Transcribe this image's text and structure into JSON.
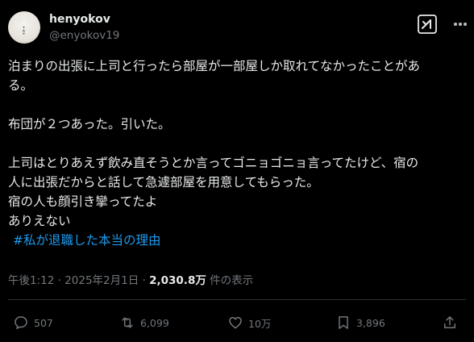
{
  "user": {
    "display_name": "henyokov",
    "handle": "@enyokov19",
    "avatar_face": "• ∧ •"
  },
  "header": {
    "grok_icon": "grok-icon",
    "more_icon": "more-options-icon"
  },
  "tweet": {
    "lines": [
      "泊まりの出張に上司と行ったら部屋が一部屋しか取れてなかったことがあ",
      "る。",
      "",
      "布団が２つあった。引いた。",
      "",
      "上司はとりあえず飲み直そうとか言ってゴニョゴニョ言ってたけど、宿の",
      "人に出張だからと話して急遽部屋を用意してもらった。",
      "宿の人も顔引き攣ってたよ",
      "ありえない"
    ],
    "hashtag": "#私が退職した本当の理由"
  },
  "meta": {
    "time": "午後1:12 · 2025年2月1日 · ",
    "views_count": "2,030.8万",
    "views_label": " 件の表示"
  },
  "actions": {
    "reply_count": "507",
    "repost_count": "6,099",
    "like_count": "10万",
    "bookmark_count": "3,896"
  },
  "colors": {
    "background": "#000000",
    "text": "#e7e9ea",
    "muted": "#71767b",
    "link": "#1d9bf0",
    "divider": "#2f3336"
  }
}
